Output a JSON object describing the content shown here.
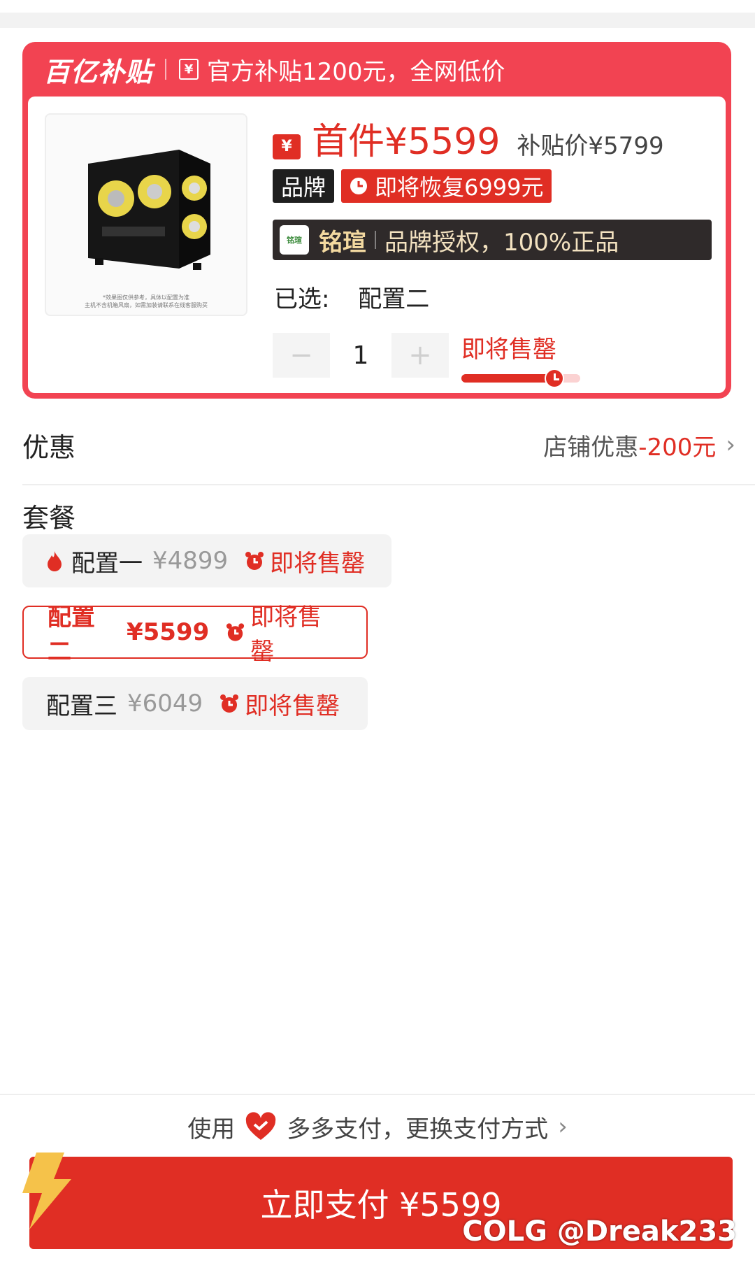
{
  "colors": {
    "accent": "#e02e24",
    "card_red": "#f24352",
    "auth_bg": "#2f2a2a"
  },
  "subsidy": {
    "logo": "百亿补贴",
    "yen_tag": "¥",
    "headline": "官方补贴1200元，全网低价"
  },
  "product": {
    "image_caption_line1": "*效果图仅供参考，具体以配置为准",
    "image_caption_line2": "主机不含机箱风扇，如需加装请联系在线客服购买",
    "coupon_icon": "¥",
    "first_price": "首件¥5599",
    "subsidy_price": "补贴价¥5799",
    "brand_tag": "品牌",
    "restore_tag": "即将恢复6999元",
    "auth_logo": "铭瑄",
    "auth_brand": "铭瑄",
    "auth_text": "品牌授权，100%正品",
    "selected_label": "已选:",
    "selected_value": "配置二",
    "quantity": "1",
    "qty_minus": "−",
    "qty_plus": "+",
    "sellout_label": "即将售罄",
    "sellout_progress": 0.78
  },
  "discount": {
    "title": "优惠",
    "label": "店铺优惠",
    "amount": "-200元",
    "chevron": "›"
  },
  "package": {
    "title": "套餐",
    "options": [
      {
        "name": "配置一",
        "price": "¥4899",
        "status": "即将售罄",
        "hot": true,
        "selected": false
      },
      {
        "name": "配置二",
        "price": "¥5599",
        "status": "即将售罄",
        "hot": false,
        "selected": true
      },
      {
        "name": "配置三",
        "price": "¥6049",
        "status": "即将售罄",
        "hot": false,
        "selected": false
      }
    ]
  },
  "payment": {
    "prefix": "使用",
    "method": "多多支付，更换支付方式",
    "chevron": "›",
    "button_label": "立即支付 ¥5599"
  },
  "watermark": "COLG @Dreak233"
}
